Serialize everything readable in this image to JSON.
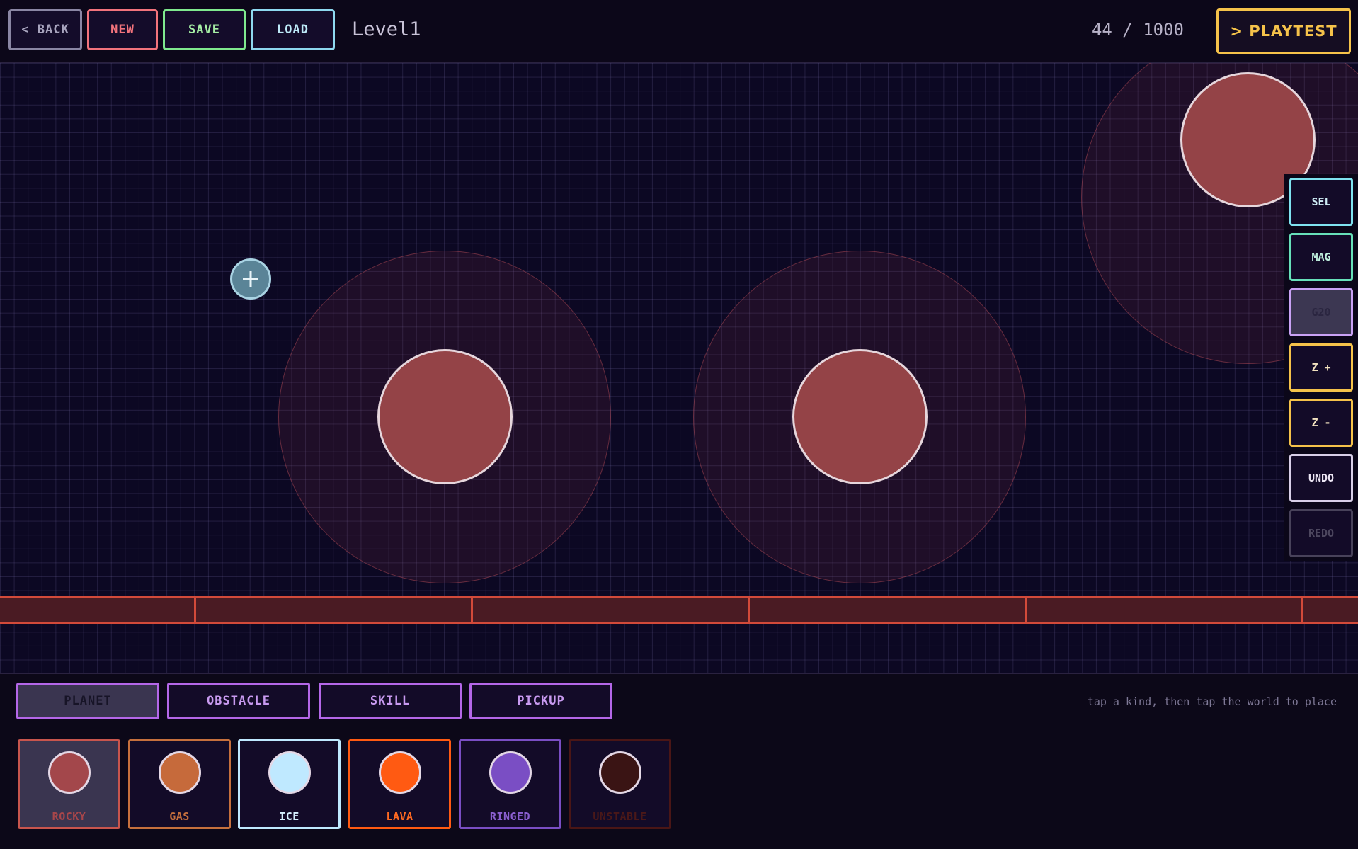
{
  "toolbar": {
    "back_label": "< BACK",
    "new_label": "NEW",
    "save_label": "SAVE",
    "load_label": "LOAD",
    "level_name": "Level1",
    "counter": "44 / 1000",
    "playtest_label": "> PLAYTEST"
  },
  "tools": [
    {
      "label": "SEL",
      "color": "#7fe3f0"
    },
    {
      "label": "MAG",
      "color": "#67e0b9"
    },
    {
      "label": "G20",
      "color": "#c9a2f5"
    },
    {
      "label": "Z +",
      "color": "#f5c24a"
    },
    {
      "label": "Z -",
      "color": "#f5c24a"
    },
    {
      "label": "UNDO",
      "color": "#d8cfe8"
    },
    {
      "label": "REDO",
      "color": "#48425a"
    }
  ],
  "palette": {
    "categories": [
      {
        "label": "PLANET",
        "active": true
      },
      {
        "label": "OBSTACLE",
        "active": false
      },
      {
        "label": "SKILL",
        "active": false
      },
      {
        "label": "PICKUP",
        "active": false
      }
    ],
    "hint": "tap a kind, then tap the world to place",
    "kinds": [
      {
        "label": "ROCKY",
        "color": "#a3474b",
        "border": "#c8554d"
      },
      {
        "label": "GAS",
        "color": "#c66a3b",
        "border": "#c6703d"
      },
      {
        "label": "ICE",
        "color": "#bfe9ff",
        "border": "#bfe9ff"
      },
      {
        "label": "LAVA",
        "color": "#ff5a12",
        "border": "#ff5a12"
      },
      {
        "label": "RINGED",
        "color": "#7a4ec4",
        "border": "#7a4ec4"
      },
      {
        "label": "UNSTABLE",
        "color": "#3a1414",
        "border": "#4a1616"
      }
    ]
  },
  "colors": {
    "background": "#0c0823",
    "planet_fill": "#944347",
    "floor": "#4a1b23",
    "floor_edge": "#d24a3a",
    "accent": "#f5c24a"
  }
}
